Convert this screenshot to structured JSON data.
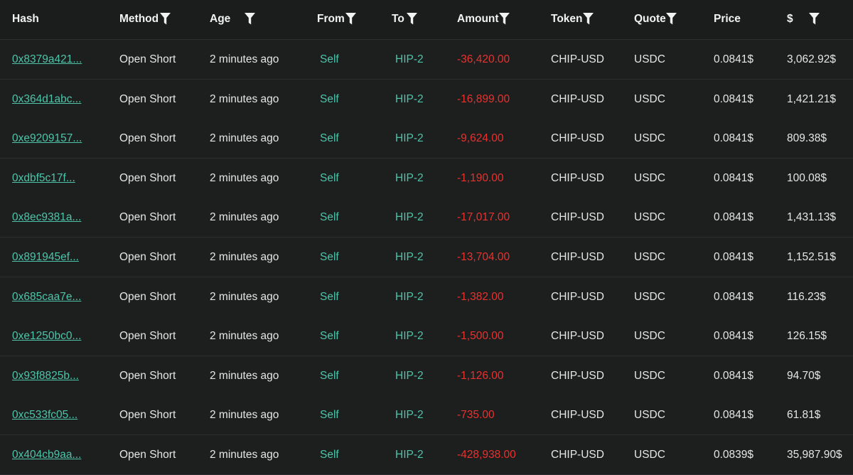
{
  "columns": {
    "hash": "Hash",
    "method": "Method",
    "age": "Age",
    "from": "From",
    "to": "To",
    "amount": "Amount",
    "token": "Token",
    "quote": "Quote",
    "price": "Price",
    "usd": "$"
  },
  "filter_icon": "filter-funnel-icon",
  "colors": {
    "background": "#1c1d1d",
    "link": "#4ec4aa",
    "negative": "#e8322f",
    "text": "#ececec"
  },
  "rows": [
    {
      "hash": "0x8379a421...",
      "method": "Open Short",
      "age": "2 minutes ago",
      "from": "Self",
      "to": "HIP-2",
      "amount": "-36,420.00",
      "token": "CHIP-USD",
      "quote": "USDC",
      "price": "0.0841$",
      "usd": "3,062.92$"
    },
    {
      "hash": "0x364d1abc...",
      "method": "Open Short",
      "age": "2 minutes ago",
      "from": "Self",
      "to": "HIP-2",
      "amount": "-16,899.00",
      "token": "CHIP-USD",
      "quote": "USDC",
      "price": "0.0841$",
      "usd": "1,421.21$"
    },
    {
      "hash": "0xe9209157...",
      "method": "Open Short",
      "age": "2 minutes ago",
      "from": "Self",
      "to": "HIP-2",
      "amount": "-9,624.00",
      "token": "CHIP-USD",
      "quote": "USDC",
      "price": "0.0841$",
      "usd": "809.38$"
    },
    {
      "hash": "0xdbf5c17f...",
      "method": "Open Short",
      "age": "2 minutes ago",
      "from": "Self",
      "to": "HIP-2",
      "amount": "-1,190.00",
      "token": "CHIP-USD",
      "quote": "USDC",
      "price": "0.0841$",
      "usd": "100.08$"
    },
    {
      "hash": "0x8ec9381a...",
      "method": "Open Short",
      "age": "2 minutes ago",
      "from": "Self",
      "to": "HIP-2",
      "amount": "-17,017.00",
      "token": "CHIP-USD",
      "quote": "USDC",
      "price": "0.0841$",
      "usd": "1,431.13$"
    },
    {
      "hash": "0x891945ef...",
      "method": "Open Short",
      "age": "2 minutes ago",
      "from": "Self",
      "to": "HIP-2",
      "amount": "-13,704.00",
      "token": "CHIP-USD",
      "quote": "USDC",
      "price": "0.0841$",
      "usd": "1,152.51$"
    },
    {
      "hash": "0x685caa7e...",
      "method": "Open Short",
      "age": "2 minutes ago",
      "from": "Self",
      "to": "HIP-2",
      "amount": "-1,382.00",
      "token": "CHIP-USD",
      "quote": "USDC",
      "price": "0.0841$",
      "usd": "116.23$"
    },
    {
      "hash": "0xe1250bc0...",
      "method": "Open Short",
      "age": "2 minutes ago",
      "from": "Self",
      "to": "HIP-2",
      "amount": "-1,500.00",
      "token": "CHIP-USD",
      "quote": "USDC",
      "price": "0.0841$",
      "usd": "126.15$"
    },
    {
      "hash": "0x93f8825b...",
      "method": "Open Short",
      "age": "2 minutes ago",
      "from": "Self",
      "to": "HIP-2",
      "amount": "-1,126.00",
      "token": "CHIP-USD",
      "quote": "USDC",
      "price": "0.0841$",
      "usd": "94.70$"
    },
    {
      "hash": "0xc533fc05...",
      "method": "Open Short",
      "age": "2 minutes ago",
      "from": "Self",
      "to": "HIP-2",
      "amount": "-735.00",
      "token": "CHIP-USD",
      "quote": "USDC",
      "price": "0.0841$",
      "usd": "61.81$"
    },
    {
      "hash": "0x404cb9aa...",
      "method": "Open Short",
      "age": "2 minutes ago",
      "from": "Self",
      "to": "HIP-2",
      "amount": "-428,938.00",
      "token": "CHIP-USD",
      "quote": "USDC",
      "price": "0.0839$",
      "usd": "35,987.90$"
    }
  ]
}
